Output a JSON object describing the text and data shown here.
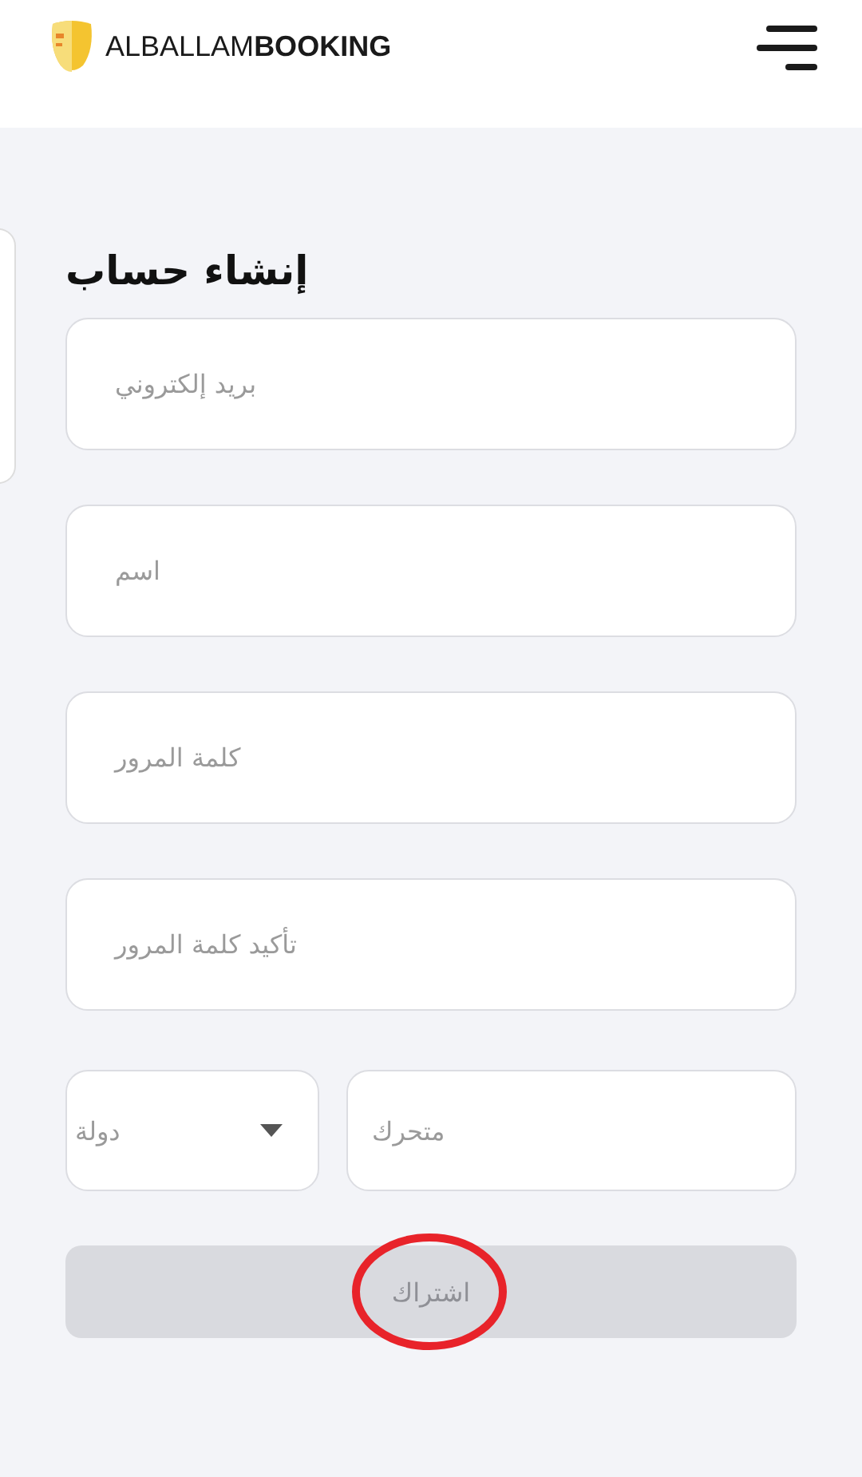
{
  "header": {
    "brand": "ALBALLAM**BOOKING**"
  },
  "form": {
    "title": "إنشاء حساب",
    "fields": [
      {
        "placeholder": "بريد إلكتروني"
      },
      {
        "placeholder": "اسم"
      },
      {
        "placeholder": "كلمة المرور"
      },
      {
        "placeholder": "تأكيد كلمة المرور"
      }
    ],
    "country": {
      "placeholder": "دولة"
    },
    "mobile": {
      "placeholder": "متحرك"
    },
    "submit": {
      "label": "اشتراك",
      "disabled": true,
      "circled": true
    }
  }
}
